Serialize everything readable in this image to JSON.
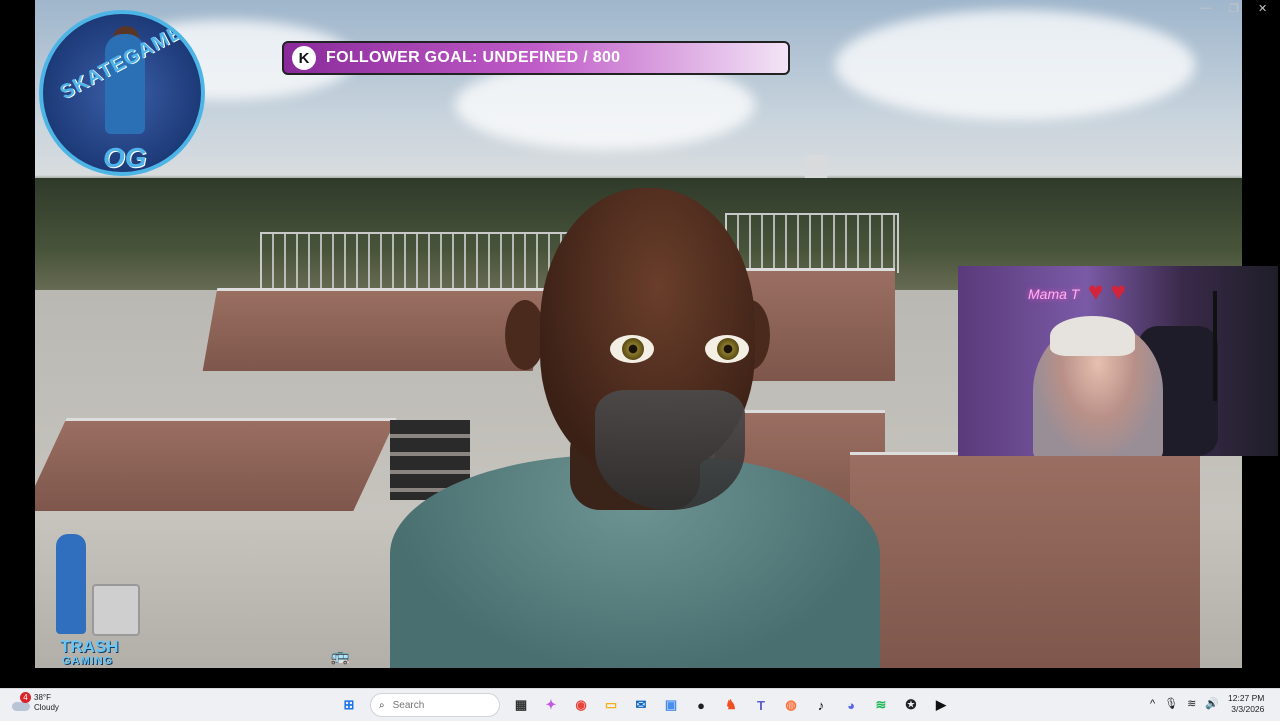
{
  "follower_goal": {
    "k_icon": "K",
    "text": "FOLLOWER GOAL: UNDEFINED / 800"
  },
  "logo": {
    "title": "SKATEGAMER",
    "sub": "OG"
  },
  "trash_gaming": {
    "line1": "TRASH",
    "line2": "GAMING"
  },
  "webcam": {
    "neon_sign": "Mama T"
  },
  "window_controls": {
    "minimize": "—",
    "restore": "❐",
    "close": "✕"
  },
  "taskbar": {
    "weather": {
      "badge": "4",
      "temp": "38°F",
      "condition": "Cloudy"
    },
    "search_placeholder": "Search",
    "apps": [
      {
        "name": "start",
        "glyph": "⊞",
        "color": "#1a73e8"
      },
      {
        "name": "task-view",
        "glyph": "▦",
        "color": "#333333"
      },
      {
        "name": "copilot",
        "glyph": "✦",
        "color": "#c25ae6"
      },
      {
        "name": "chrome",
        "glyph": "◉",
        "color": "#e8453c"
      },
      {
        "name": "file-explorer",
        "glyph": "▭",
        "color": "#f2b01e"
      },
      {
        "name": "outlook",
        "glyph": "✉",
        "color": "#0a66c2"
      },
      {
        "name": "phone-link",
        "glyph": "▣",
        "color": "#4a8ff0"
      },
      {
        "name": "app-dark",
        "glyph": "●",
        "color": "#202020"
      },
      {
        "name": "brave",
        "glyph": "♞",
        "color": "#f04e23"
      },
      {
        "name": "teams",
        "glyph": "T",
        "color": "#5b5fc7"
      },
      {
        "name": "firefox",
        "glyph": "◍",
        "color": "#ff7139"
      },
      {
        "name": "tiktok",
        "glyph": "♪",
        "color": "#000000"
      },
      {
        "name": "discord",
        "glyph": "◕",
        "color": "#5865f2"
      },
      {
        "name": "spotify",
        "glyph": "≋",
        "color": "#1db954"
      },
      {
        "name": "game-app",
        "glyph": "✪",
        "color": "#222222"
      },
      {
        "name": "media-player",
        "glyph": "▶",
        "color": "#111111"
      }
    ],
    "tray": {
      "chevron": "^",
      "mic": "🎙",
      "wifi": "≋",
      "volume": "🔊"
    },
    "time": "12:27 PM",
    "date": "3/3/2026"
  }
}
